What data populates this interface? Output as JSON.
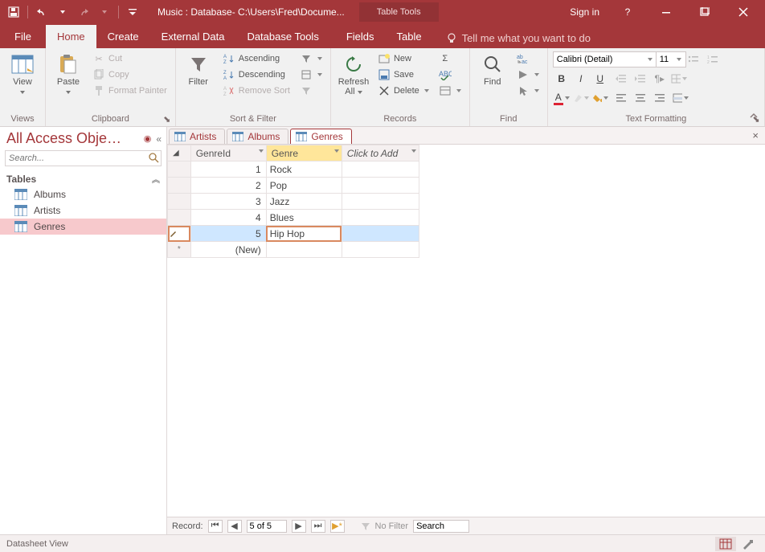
{
  "titlebar": {
    "title": "Music : Database- C:\\Users\\Fred\\Docume...",
    "tools_label": "Table Tools",
    "signin": "Sign in"
  },
  "ribbon_tabs": {
    "file": "File",
    "home": "Home",
    "create": "Create",
    "external": "External Data",
    "dbtools": "Database Tools",
    "fields": "Fields",
    "table": "Table",
    "tellme": "Tell me what you want to do"
  },
  "ribbon": {
    "views": {
      "label": "Views",
      "view": "View"
    },
    "clipboard": {
      "label": "Clipboard",
      "paste": "Paste",
      "cut": "Cut",
      "copy": "Copy",
      "format_painter": "Format Painter"
    },
    "sortfilter": {
      "label": "Sort & Filter",
      "filter": "Filter",
      "ascending": "Ascending",
      "descending": "Descending",
      "remove_sort": "Remove Sort"
    },
    "records": {
      "label": "Records",
      "refresh": "Refresh All",
      "new": "New",
      "save": "Save",
      "delete": "Delete"
    },
    "find": {
      "label": "Find",
      "find": "Find"
    },
    "textfmt": {
      "label": "Text Formatting",
      "font_name": "Calibri (Detail)",
      "font_size": "11"
    }
  },
  "nav": {
    "title": "All Access Obje…",
    "search_placeholder": "Search...",
    "group": "Tables",
    "items": [
      "Albums",
      "Artists",
      "Genres"
    ],
    "active_index": 2
  },
  "tabs": {
    "items": [
      "Artists",
      "Albums",
      "Genres"
    ],
    "active_index": 2
  },
  "datasheet": {
    "columns": [
      "GenreId",
      "Genre"
    ],
    "click_to_add": "Click to Add",
    "rows": [
      {
        "id": "1",
        "genre": "Rock"
      },
      {
        "id": "2",
        "genre": "Pop"
      },
      {
        "id": "3",
        "genre": "Jazz"
      },
      {
        "id": "4",
        "genre": "Blues"
      },
      {
        "id": "5",
        "genre": "Hip Hop"
      }
    ],
    "new_label": "(New)",
    "editing_row_index": 4
  },
  "recnav": {
    "label": "Record:",
    "position": "5 of 5",
    "no_filter": "No Filter",
    "search": "Search"
  },
  "status": {
    "view": "Datasheet View"
  }
}
